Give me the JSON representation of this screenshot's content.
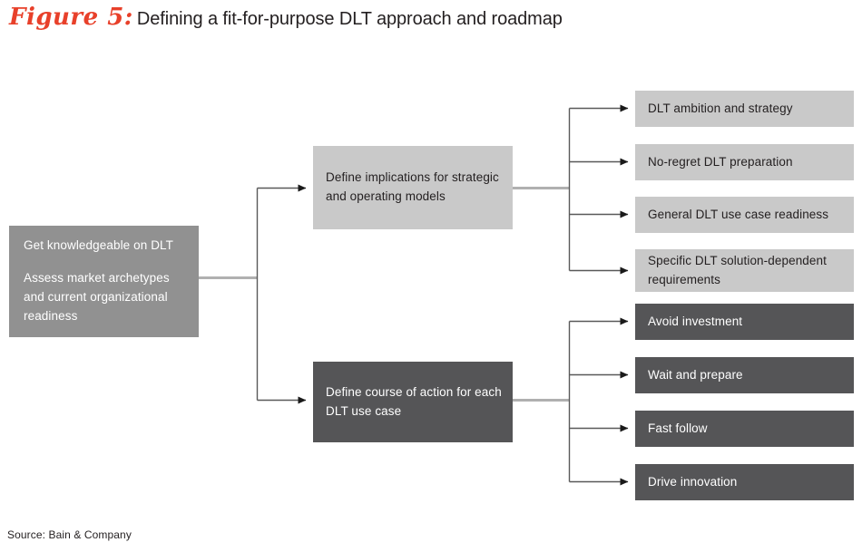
{
  "title": {
    "figure_label": "Figure 5:",
    "text": "Defining a fit-for-purpose DLT approach and roadmap"
  },
  "colors": {
    "accent_red": "#e8402a",
    "tone_mid": "#919191",
    "tone_light": "#c9c9c9",
    "tone_dark": "#555557",
    "connector_dark": "#595959",
    "connector_light": "#b0b0b0",
    "text_dark": "#231f20",
    "text_light": "#ffffff",
    "background": "#ffffff"
  },
  "diagram": {
    "type": "flow-tree",
    "root": {
      "id": "root",
      "tone": "mid",
      "lines": [
        "Get knowledgeable on DLT",
        "",
        "Assess market archetypes",
        "and current organizational",
        "readiness"
      ]
    },
    "branches": [
      {
        "id": "strategic",
        "tone": "light",
        "lines": [
          "Define implications for strategic",
          "and operating models"
        ],
        "leaves": [
          {
            "id": "ambition",
            "tone": "light",
            "lines": [
              "DLT ambition and strategy"
            ]
          },
          {
            "id": "noregret",
            "tone": "light",
            "lines": [
              "No-regret DLT preparation"
            ]
          },
          {
            "id": "general",
            "tone": "light",
            "lines": [
              "General DLT use case readiness"
            ]
          },
          {
            "id": "specific",
            "tone": "light",
            "lines": [
              "Specific DLT solution-dependent",
              "requirements"
            ]
          }
        ]
      },
      {
        "id": "course",
        "tone": "dark",
        "lines": [
          "Define course of action for each",
          "DLT use case"
        ],
        "leaves": [
          {
            "id": "avoid",
            "tone": "dark",
            "lines": [
              "Avoid investment"
            ]
          },
          {
            "id": "wait",
            "tone": "dark",
            "lines": [
              "Wait and prepare"
            ]
          },
          {
            "id": "fast",
            "tone": "dark",
            "lines": [
              "Fast follow"
            ]
          },
          {
            "id": "drive",
            "tone": "dark",
            "lines": [
              "Drive innovation"
            ]
          }
        ]
      }
    ]
  },
  "source": "Source: Bain & Company"
}
